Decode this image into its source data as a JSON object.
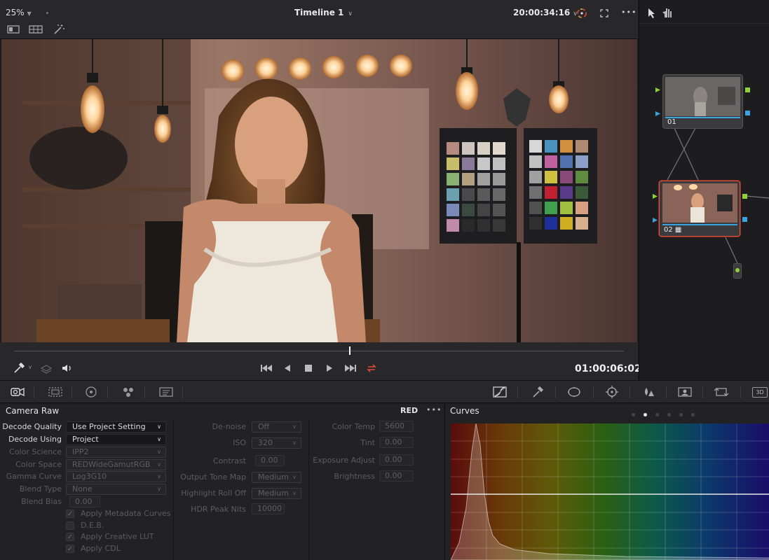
{
  "viewer_header": {
    "zoom": "25%",
    "timeline_title": "Timeline 1",
    "timecode": "20:00:34:16"
  },
  "transport": {
    "timecode": "01:00:06:02"
  },
  "nodes": [
    {
      "label": "01"
    },
    {
      "label": "02"
    }
  ],
  "camera_raw": {
    "title": "Camera Raw",
    "format": "RED",
    "col1": {
      "decode_quality": {
        "label": "Decode Quality",
        "value": "Use Project Setting"
      },
      "decode_using": {
        "label": "Decode Using",
        "value": "Project"
      },
      "color_science": {
        "label": "Color Science",
        "value": "IPP2"
      },
      "color_space": {
        "label": "Color Space",
        "value": "REDWideGamutRGB"
      },
      "gamma_curve": {
        "label": "Gamma Curve",
        "value": "Log3G10"
      },
      "blend_type": {
        "label": "Blend Type",
        "value": "None"
      },
      "blend_bias": {
        "label": "Blend Bias",
        "value": "0.00"
      },
      "checkboxes": [
        {
          "label": "Apply Metadata Curves",
          "checked": true
        },
        {
          "label": "D.E.B.",
          "checked": false
        },
        {
          "label": "Apply Creative LUT",
          "checked": true
        },
        {
          "label": "Apply CDL",
          "checked": true
        }
      ]
    },
    "col2": {
      "denoise": {
        "label": "De-noise",
        "value": "Off"
      },
      "iso": {
        "label": "ISO",
        "value": "320"
      },
      "contrast": {
        "label": "Contrast",
        "value": "0.00"
      },
      "output_tone_map": {
        "label": "Output Tone Map",
        "value": "Medium"
      },
      "highlight_roll_off": {
        "label": "Highlight Roll Off",
        "value": "Medium"
      },
      "hdr_peak_nits": {
        "label": "HDR Peak Nits",
        "value": "10000"
      }
    },
    "col3": {
      "color_temp": {
        "label": "Color Temp",
        "value": "5600"
      },
      "tint": {
        "label": "Tint",
        "value": "0.00"
      },
      "exposure_adjust": {
        "label": "Exposure Adjust",
        "value": "0.00"
      },
      "brightness": {
        "label": "Brightness",
        "value": "0.00"
      }
    }
  },
  "curves": {
    "title": "Curves",
    "page_dots": 6,
    "active_page": 2
  },
  "colors": {
    "accent_red": "#e04a3a",
    "node_port_green": "#8fd13a",
    "node_port_blue": "#3aa3e0",
    "selection_outline": "#d9543f"
  }
}
